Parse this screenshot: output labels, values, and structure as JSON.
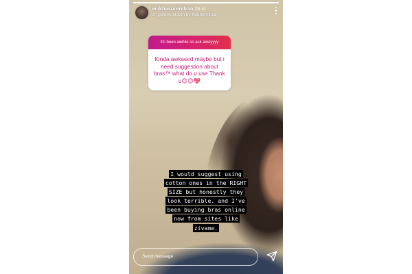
{
  "story": {
    "progress": 1.0,
    "user": {
      "username": "anikhasurendran",
      "time_ago": "29 m"
    },
    "music": {
      "icon": "music-note-icon",
      "track": "golden bloom",
      "by_label": "by",
      "artist": "hadhotmirza"
    },
    "question_sticker": {
      "prompt": "it's been awhile so ask awayyyy",
      "question": "Kinda awkward maybe but i need suggestion about bras™ what do u use Thank u😊😊💖",
      "header_gradient": [
        "#c21a8c",
        "#e0304a"
      ],
      "text_color": "#c51e78"
    },
    "caption_lines": [
      "I would suggest using",
      "cotton ones in the RIGHT",
      "SIZE but honestly they",
      "look terrible. and I've",
      "been buying bras online",
      "now from sites like",
      "zivame."
    ],
    "reply": {
      "placeholder": "Send message",
      "send_icon": "paper-plane-icon"
    },
    "menu_icon": "more-vertical-icon"
  }
}
